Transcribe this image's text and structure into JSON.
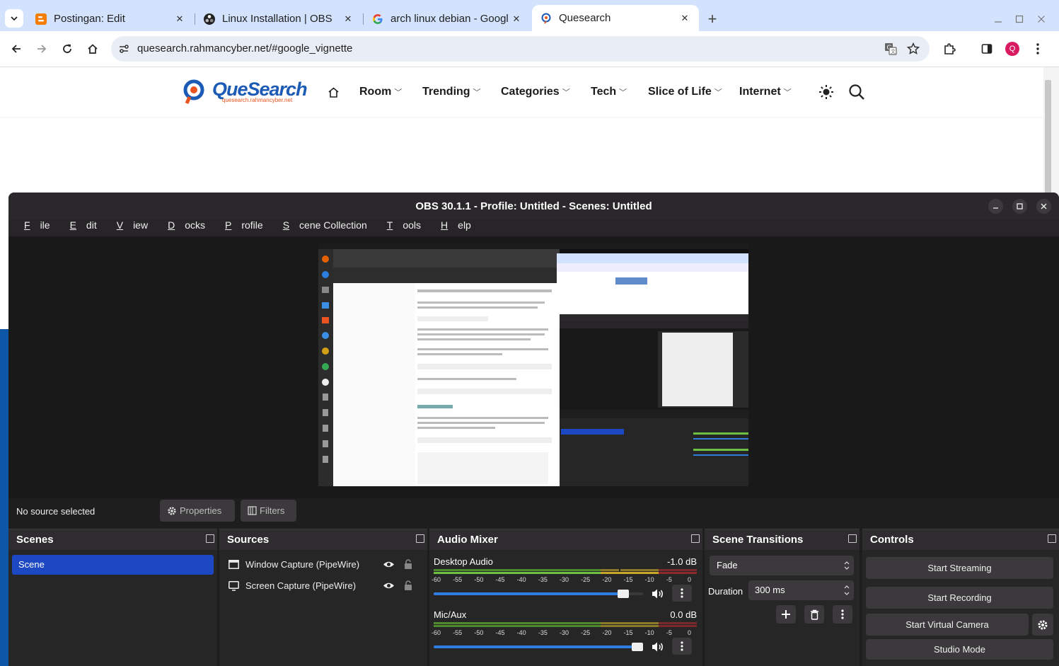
{
  "browser": {
    "tabs": [
      {
        "title": "Postingan: Edit",
        "icon": "blogger-icon"
      },
      {
        "title": "Linux Installation | OBS",
        "icon": "obs-icon"
      },
      {
        "title": "arch linux debian - Googl",
        "icon": "google-icon"
      },
      {
        "title": "Quesearch",
        "icon": "quesearch-icon"
      }
    ],
    "new_tab": "+",
    "url": "quesearch.rahmancyber.net/#google_vignette",
    "profile_initial": "Q",
    "colors": {
      "tabstrip": "#d3e3fd",
      "profile": "#d81b60",
      "accent": "#0b57d0"
    }
  },
  "site": {
    "logo_text": "QueSearch",
    "logo_sub": "quesearch.rahmancyber.net",
    "nav": [
      "Room",
      "Trending",
      "Categories",
      "Tech",
      "Slice of Life",
      "Internet"
    ],
    "colors": {
      "logo_blue": "#1b5ab5",
      "logo_orange": "#e8531e"
    }
  },
  "obs": {
    "title": "OBS 30.1.1 - Profile: Untitled - Scenes: Untitled",
    "menu": [
      {
        "u": "F",
        "rest": "ile"
      },
      {
        "u": "E",
        "rest": "dit"
      },
      {
        "u": "V",
        "rest": "iew"
      },
      {
        "u": "D",
        "rest": "ocks"
      },
      {
        "u": "P",
        "rest": "rofile"
      },
      {
        "u": "S",
        "rest": "cene Collection"
      },
      {
        "u": "T",
        "rest": "ools"
      },
      {
        "u": "H",
        "rest": "elp"
      }
    ],
    "source_status": "No source selected",
    "properties_label": "Properties",
    "filters_label": "Filters",
    "scenes": {
      "title": "Scenes",
      "items": [
        "Scene"
      ]
    },
    "sources": {
      "title": "Sources",
      "items": [
        "Window Capture (PipeWire)",
        "Screen Capture (PipeWire)"
      ]
    },
    "mixer": {
      "title": "Audio Mixer",
      "channels": [
        {
          "name": "Desktop Audio",
          "db": "-1.0 dB",
          "volume": 0.93
        },
        {
          "name": "Mic/Aux",
          "db": "0.0 dB",
          "volume": 1.0
        }
      ],
      "ticks": [
        "-60",
        "-55",
        "-50",
        "-45",
        "-40",
        "-35",
        "-30",
        "-25",
        "-20",
        "-15",
        "-10",
        "-5",
        "0"
      ]
    },
    "transitions": {
      "title": "Scene Transitions",
      "selected": "Fade",
      "duration_label": "Duration",
      "duration": "300 ms"
    },
    "controls": {
      "title": "Controls",
      "start_streaming": "Start Streaming",
      "start_recording": "Start Recording",
      "start_virtual_camera": "Start Virtual Camera",
      "studio_mode": "Studio Mode"
    },
    "colors": {
      "bg": "#1f1e1f",
      "dock": "#272627",
      "selection": "#1c48c4",
      "button": "#3b393b",
      "slider": "#2f7de1"
    }
  }
}
